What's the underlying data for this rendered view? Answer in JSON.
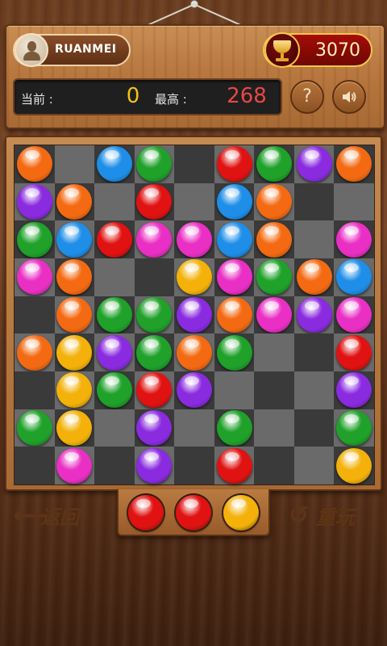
{
  "header": {
    "username": "RUANMEI",
    "gold": "3070",
    "current_label": "当前 :",
    "current_value": "0",
    "best_label": "最高 :",
    "best_value": "268",
    "help_icon": "?",
    "sound_icon": "speaker-icon"
  },
  "colors": {
    "orange": "#f46a12",
    "blue": "#1e8ee8",
    "green": "#1fa12a",
    "red": "#e01212",
    "purple": "#8a2be0",
    "pink": "#ea2fc4",
    "yellow": "#f3b10a"
  },
  "board": {
    "rows": 9,
    "cols": 9,
    "cells": [
      [
        "orange",
        "",
        "blue",
        "green",
        "",
        "red",
        "green",
        "purple",
        "orange"
      ],
      [
        "purple",
        "orange",
        "",
        "red",
        "",
        "blue",
        "orange",
        "",
        ""
      ],
      [
        "green",
        "blue",
        "red",
        "pink",
        "pink",
        "blue",
        "orange",
        "",
        "pink"
      ],
      [
        "pink",
        "orange",
        "",
        "",
        "yellow",
        "pink",
        "green",
        "orange",
        "blue"
      ],
      [
        "",
        "orange",
        "green",
        "green",
        "purple",
        "orange",
        "pink",
        "purple",
        "pink"
      ],
      [
        "orange",
        "yellow",
        "purple",
        "green",
        "orange",
        "green",
        "",
        "",
        "red"
      ],
      [
        "",
        "yellow",
        "green",
        "red",
        "purple",
        "",
        "",
        "",
        "purple"
      ],
      [
        "green",
        "yellow",
        "",
        "purple",
        "",
        "green",
        "",
        "",
        "green"
      ],
      [
        "",
        "pink",
        "",
        "purple",
        "",
        "red",
        "",
        "",
        "yellow"
      ]
    ]
  },
  "next_balls": [
    "red",
    "red",
    "yellow"
  ],
  "footer": {
    "back_label": "返回",
    "replay_label": "重玩"
  }
}
